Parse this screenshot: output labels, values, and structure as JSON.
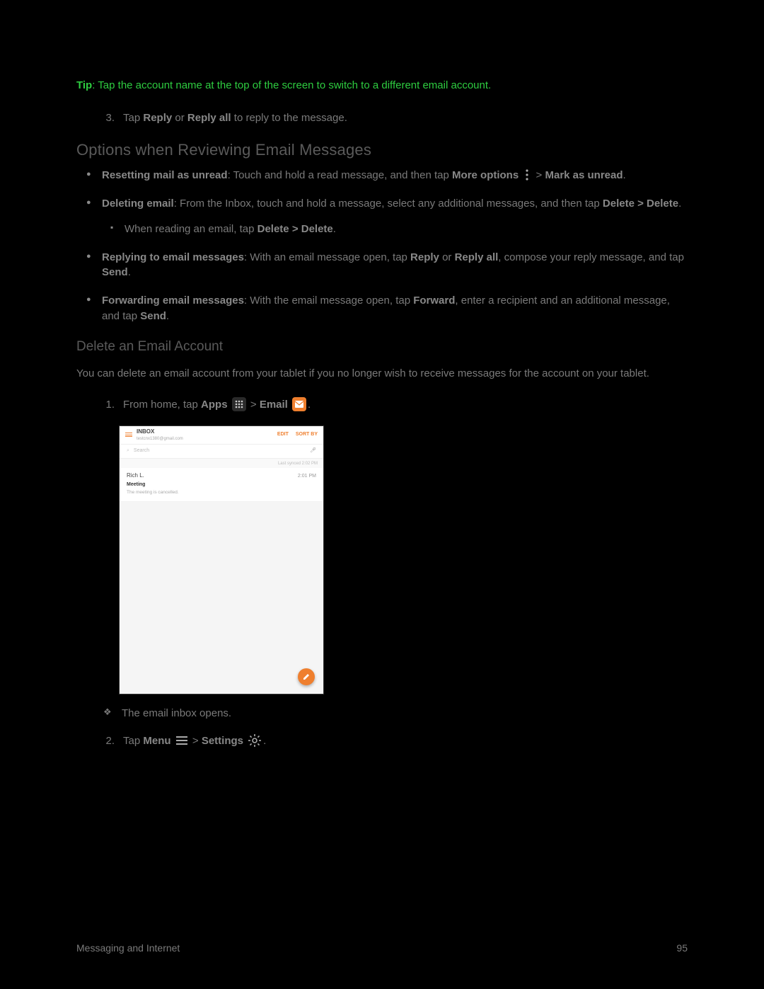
{
  "tip": {
    "label": "Tip",
    "text": ": Tap the account name at the top of the screen to switch to a different email account."
  },
  "step3": {
    "num": "3.",
    "pre": "Tap ",
    "b1": "Reply",
    "mid": " or ",
    "b2": "Reply all",
    "post": " to reply to the message."
  },
  "heading1": "Options when Reviewing Email Messages",
  "bul": {
    "reset": {
      "b": "Resetting mail as unread",
      "t1": ": Touch and hold a read message, and then tap ",
      "more": "More options",
      "gt": " > ",
      "mark": "Mark as unread"
    },
    "del": {
      "b": "Deleting email",
      "t1": ": From the Inbox, touch and hold a message, select any additional messages, and then tap ",
      "dd": "Delete > Delete"
    },
    "del_sub": {
      "pre": "When reading an email, tap ",
      "dd": "Delete > Delete"
    },
    "reply": {
      "b": "Replying to email messages",
      "t1": ": With an email message open, tap ",
      "r": "Reply",
      "or": " or ",
      "ra": "Reply all",
      "t2": ", compose your reply message, and tap ",
      "send": "Send"
    },
    "fwd": {
      "b": "Forwarding email messages",
      "t1": ": With the email message open, tap ",
      "f": "Forward",
      "t2": ", enter a recipient and an additional message, and tap ",
      "send": "Send"
    }
  },
  "heading2": "Delete an Email Account",
  "para2": "You can delete an email account from your tablet if you no longer wish to receive messages for the account on your tablet.",
  "step1b": {
    "num": "1.",
    "pre": "From home, tap ",
    "apps": "Apps",
    "gt": " > ",
    "email": "Email",
    "dot": "."
  },
  "diamond1": "The email inbox opens.",
  "step2b": {
    "num": "2.",
    "pre": "Tap ",
    "menu": "Menu",
    "gt": " > ",
    "settings": "Settings",
    "dot": "."
  },
  "tablet": {
    "inbox": "INBOX",
    "account": "testcnx1380@gmail.com",
    "edit": "EDIT",
    "sort": "SORT BY",
    "search": "Search",
    "sync": "Last synced  2:02 PM",
    "sender": "Rich L.",
    "time": "2:01 PM",
    "subject": "Meeting",
    "preview": "The meeting is cancelled."
  },
  "footer": {
    "left": "Messaging and Internet",
    "right": "95"
  }
}
